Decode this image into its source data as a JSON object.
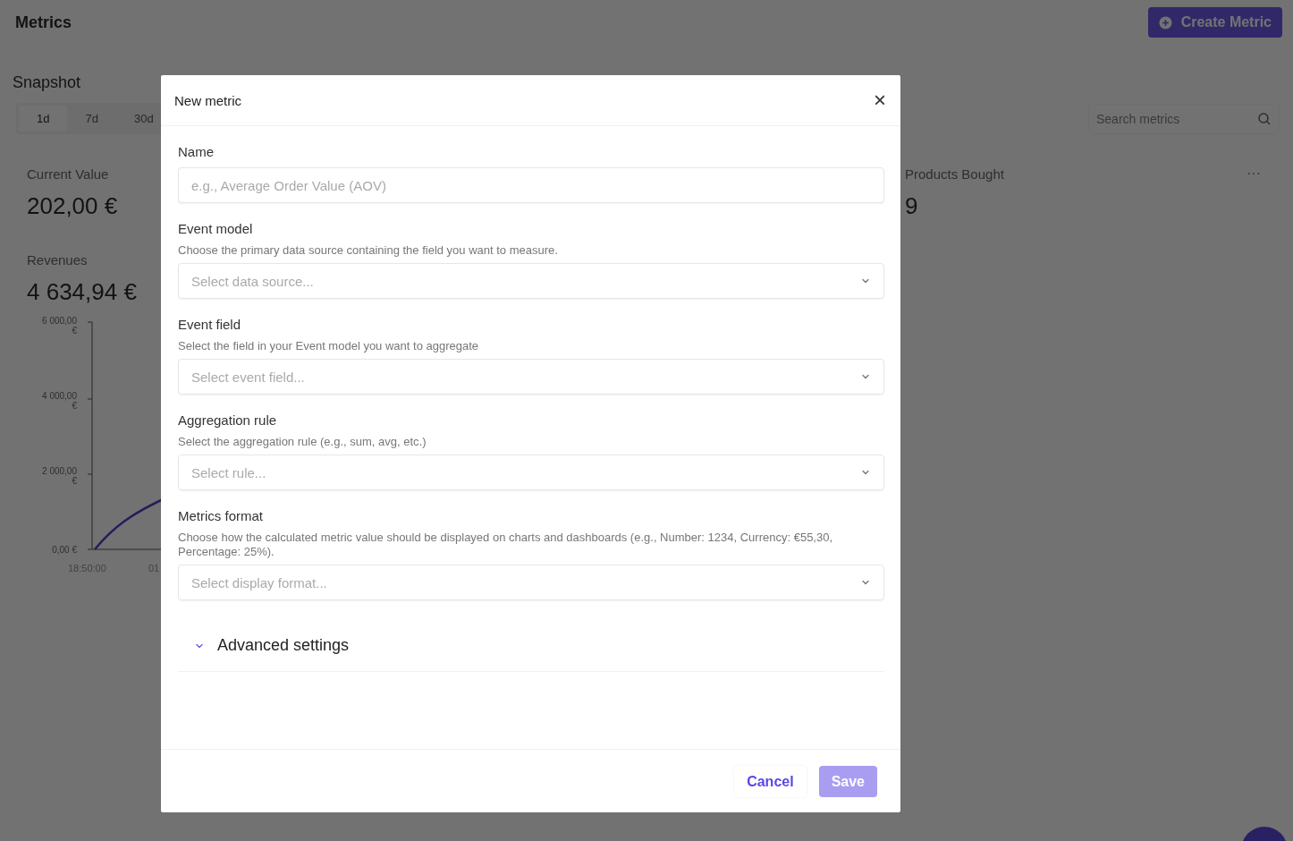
{
  "page": {
    "title": "Metrics",
    "create_button": "Create Metric",
    "section_title": "Snapshot",
    "ranges": [
      {
        "label": "1d",
        "selected": true
      },
      {
        "label": "7d",
        "selected": false
      },
      {
        "label": "30d",
        "selected": false
      }
    ],
    "search": {
      "placeholder": "Search metrics"
    },
    "left_cards": [
      {
        "title": "Current Value",
        "value": "202,00 €"
      },
      {
        "title": "Revenues",
        "value": "4 634,94 €",
        "chart": {
          "y_tick_labels": [
            "6 000,00 €",
            "4 000,00 €",
            "2 000,00 €",
            "0,00 €"
          ],
          "x_tick_labels": [
            "18:50:00",
            "01"
          ]
        }
      }
    ],
    "right_cards": [
      {
        "title": "Products Bought",
        "value": "9",
        "menu": "···"
      }
    ]
  },
  "modal": {
    "title": "New metric",
    "close": "×",
    "fields": [
      {
        "kind": "text",
        "label": "Name",
        "placeholder": "e.g., Average Order Value (AOV)"
      },
      {
        "kind": "select",
        "label": "Event model",
        "description": "Choose the primary data source containing the field you want to measure.",
        "placeholder": "Select data source..."
      },
      {
        "kind": "select",
        "label": "Event field",
        "description": "Select the field in your Event model you want to aggregate",
        "placeholder": "Select event field..."
      },
      {
        "kind": "select",
        "label": "Aggregation rule",
        "description": "Select the aggregation rule (e.g., sum, avg, etc.)",
        "placeholder": "Select rule..."
      },
      {
        "kind": "select",
        "label": "Metrics format",
        "description": "Choose how the calculated metric value should be displayed on charts and dashboards (e.g., Number: 1234, Currency: €55,30, Percentage: 25%).",
        "placeholder": "Select display format..."
      }
    ],
    "advanced": {
      "label": "Advanced settings",
      "expanded": false
    },
    "buttons": [
      {
        "kind": "secondary",
        "label": "Cancel",
        "disabled": false
      },
      {
        "kind": "primary",
        "label": "Save",
        "disabled": true
      }
    ]
  }
}
